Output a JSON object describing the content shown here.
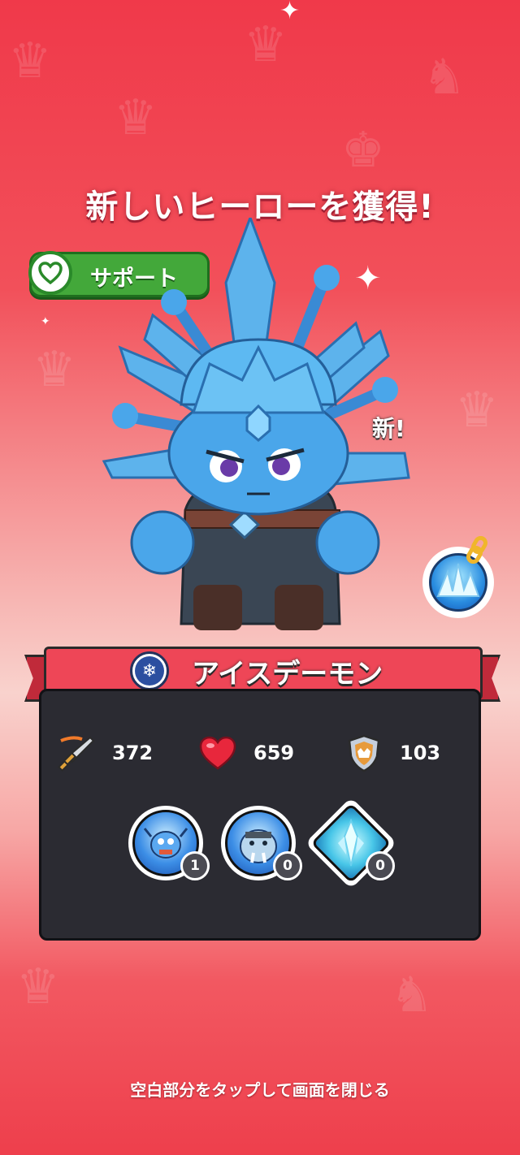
{
  "header": {
    "title": "新しいヒーローを獲得!"
  },
  "role_badge": {
    "label": "サポート",
    "icon": "heart-icon"
  },
  "hero": {
    "new_tag": "新!",
    "name": "アイスデーモン",
    "element_icon": "snowflake-icon",
    "skill_icon": "ice-crystal-skill-icon",
    "stats": [
      {
        "icon": "sword-attack-icon",
        "value": "372"
      },
      {
        "icon": "heart-hp-icon",
        "value": "659"
      },
      {
        "icon": "shield-defense-icon",
        "value": "103"
      }
    ],
    "runes": [
      {
        "icon": "fish-rune-icon",
        "count": "1"
      },
      {
        "icon": "walrus-rune-icon",
        "count": "0"
      },
      {
        "icon": "ice-crystal-rune-icon",
        "count": "0"
      }
    ]
  },
  "footer": {
    "hint": "空白部分をタップして画面を閉じる"
  },
  "colors": {
    "background": "#f0394a",
    "banner": "#ee4657",
    "panel": "#2b2b32",
    "support_green": "#43a83a"
  }
}
